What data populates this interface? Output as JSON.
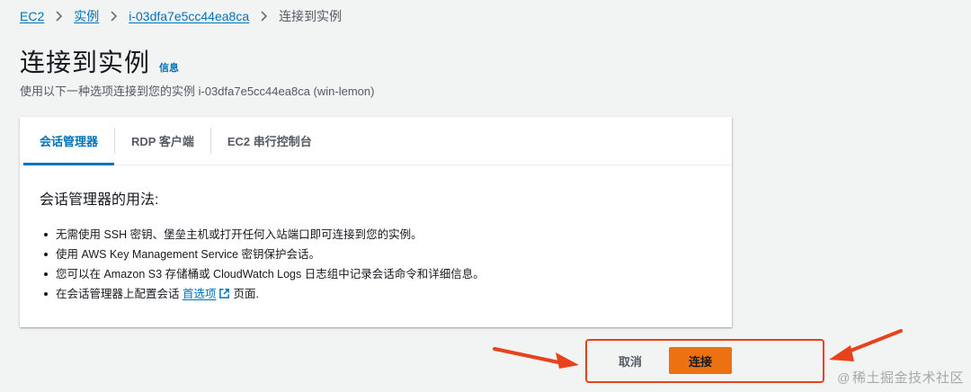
{
  "breadcrumb": {
    "items": [
      "EC2",
      "实例",
      "i-03dfa7e5cc44ea8ca"
    ],
    "current": "连接到实例"
  },
  "header": {
    "title": "连接到实例",
    "info_label": "信息",
    "description": "使用以下一种选项连接到您的实例 i-03dfa7e5cc44ea8ca (win-lemon)"
  },
  "tabs": [
    {
      "label": "会话管理器",
      "active": true
    },
    {
      "label": "RDP 客户端",
      "active": false
    },
    {
      "label": "EC2 串行控制台",
      "active": false
    }
  ],
  "session_manager": {
    "heading": "会话管理器的用法:",
    "bullets": [
      "无需使用 SSH 密钥、堡垒主机或打开任何入站端口即可连接到您的实例。",
      "使用 AWS Key Management Service 密钥保护会话。",
      "您可以在 Amazon S3 存储桶或 CloudWatch Logs 日志组中记录会话命令和详细信息。"
    ],
    "pref_prefix": "在会话管理器上配置会话",
    "pref_link": "首选项",
    "pref_suffix": "页面."
  },
  "actions": {
    "cancel_label": "取消",
    "connect_label": "连接"
  },
  "watermark": {
    "symbol": "@",
    "text": "稀土掘金技术社区"
  },
  "colors": {
    "link": "#0073bb",
    "primary_button": "#ec7211",
    "annotation": "#e8421c"
  }
}
